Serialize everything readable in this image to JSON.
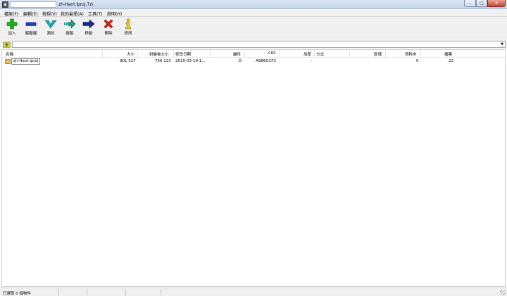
{
  "window": {
    "title": "zh-Hant.lproj.7z\\",
    "controls": {
      "minimize": "–",
      "maximize": "□",
      "close": "✕"
    }
  },
  "menu": [
    "檔案(F)",
    "編輯(E)",
    "檢視(V)",
    "我的最愛(A)",
    "工具(T)",
    "說明(H)"
  ],
  "toolbar": [
    {
      "label": "加入",
      "icon": "add-icon",
      "color": "#1fb31f"
    },
    {
      "label": "解壓縮",
      "icon": "extract-icon",
      "color": "#1e3fb8"
    },
    {
      "label": "測試",
      "icon": "test-icon",
      "color": "#21a9b8"
    },
    {
      "label": "複製",
      "icon": "copy-icon",
      "color": "#1e9c8c"
    },
    {
      "label": "移動",
      "icon": "move-icon",
      "color": "#1a2a8a"
    },
    {
      "label": "刪除",
      "icon": "delete-icon",
      "color": "#d0201c"
    },
    {
      "label": "資訊",
      "icon": "info-icon",
      "color": "#e7d21a"
    }
  ],
  "address": {
    "value": ""
  },
  "columns": {
    "name": "名稱",
    "size": "大小",
    "packed": "封裝後大小",
    "modified": "修改日期",
    "attr": "屬性",
    "crc": "CRC",
    "encrypted": "加密",
    "method": "方式",
    "block": "區塊",
    "folders": "資料夾",
    "files": "檔案"
  },
  "rows": [
    {
      "name": "zh-Hant.lproj",
      "size": "901 527",
      "packed": "756 123",
      "modified": "2015-03-19 1...",
      "attr": "D",
      "crc": "A5B6CCF3",
      "encrypted": "-",
      "method": "",
      "block": "",
      "folders": "0",
      "files": "23"
    }
  ],
  "status": {
    "selected": "已選取 0 個物件"
  }
}
